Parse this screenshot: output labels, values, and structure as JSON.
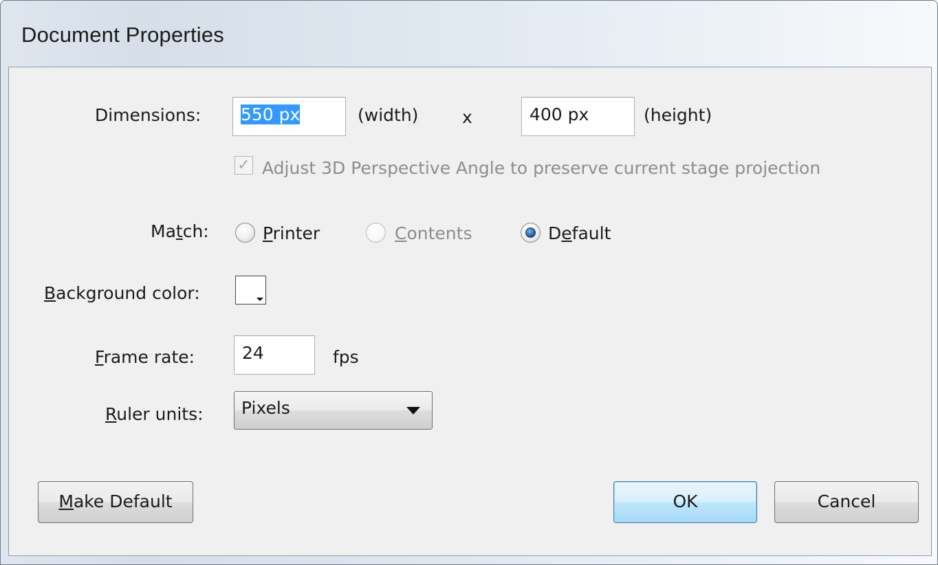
{
  "window": {
    "title": "Document Properties"
  },
  "dimensions": {
    "label": "Dimensions:",
    "width_value": "550 px",
    "width_suffix": "(width)",
    "separator": "x",
    "height_value": "400 px",
    "height_suffix": "(height)",
    "adjust_3d_checked": true,
    "adjust_3d_label": "Adjust 3D Perspective Angle to preserve current stage projection"
  },
  "match": {
    "label": "Match:",
    "options": [
      {
        "label": "Printer",
        "selected": false,
        "enabled": true
      },
      {
        "label": "Contents",
        "selected": false,
        "enabled": false
      },
      {
        "label": "Default",
        "selected": true,
        "enabled": true
      }
    ]
  },
  "background_color": {
    "label": "Background color:",
    "value": "#ffffff"
  },
  "frame_rate": {
    "label": "Frame rate:",
    "value": "24",
    "unit": "fps"
  },
  "ruler_units": {
    "label": "Ruler units:",
    "selected": "Pixels"
  },
  "buttons": {
    "make_default": "Make Default",
    "ok": "OK",
    "cancel": "Cancel"
  },
  "colors": {
    "accent_selection": "#3399ff",
    "default_button_border": "#3c7fb1",
    "disabled_text": "#8d8d8d"
  }
}
